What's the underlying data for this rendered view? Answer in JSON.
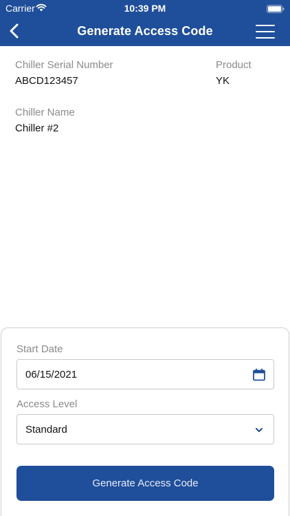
{
  "status_bar": {
    "carrier": "Carrier",
    "time": "10:39 PM"
  },
  "nav": {
    "title": "Generate Access Code",
    "back_icon": "chevron-left-icon",
    "menu_icon": "hamburger-menu-icon"
  },
  "chiller": {
    "serial_label": "Chiller Serial Number",
    "serial_value": "ABCD123457",
    "product_label": "Product",
    "product_value": "YK",
    "name_label": "Chiller Name",
    "name_value": "Chiller #2"
  },
  "form": {
    "start_date_label": "Start Date",
    "start_date_value": "06/15/2021",
    "access_level_label": "Access Level",
    "access_level_value": "Standard",
    "submit_label": "Generate Access Code"
  },
  "colors": {
    "brand_blue": "#1f4e9a",
    "label_gray": "#8a8a8a"
  }
}
